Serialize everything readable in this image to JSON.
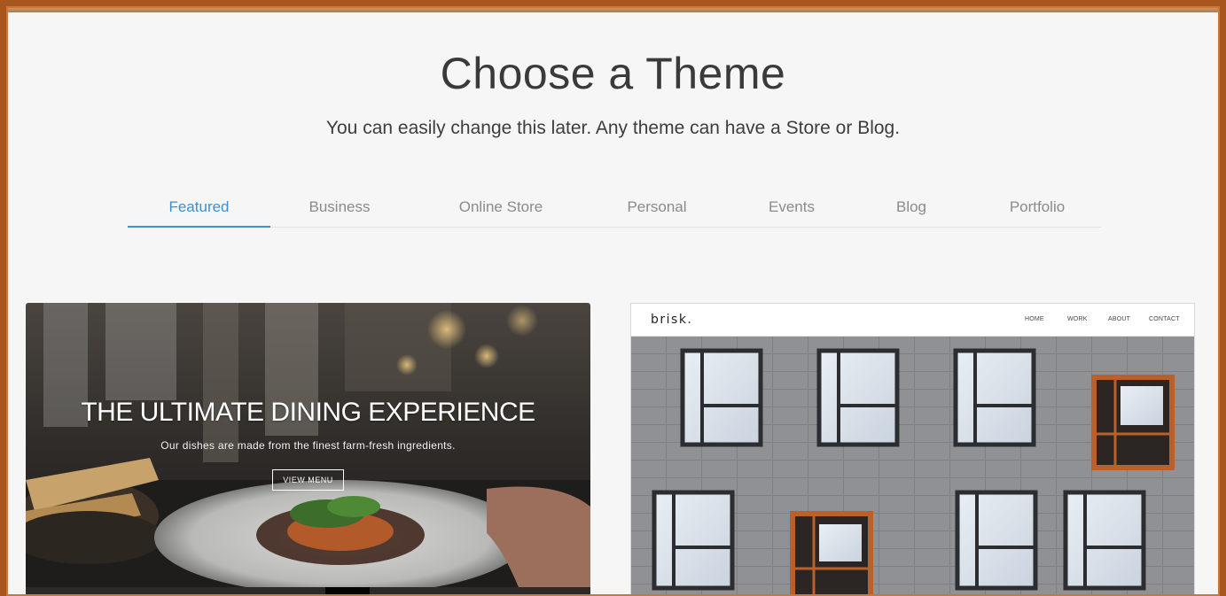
{
  "heading": {
    "title": "Choose a Theme",
    "subtitle": "You can easily change this later. Any theme can have a Store or Blog."
  },
  "tabs": [
    {
      "label": "Featured",
      "active": true
    },
    {
      "label": "Business",
      "active": false
    },
    {
      "label": "Online Store",
      "active": false
    },
    {
      "label": "Personal",
      "active": false
    },
    {
      "label": "Events",
      "active": false
    },
    {
      "label": "Blog",
      "active": false
    },
    {
      "label": "Portfolio",
      "active": false
    }
  ],
  "colors": {
    "accent": "#3d8fd1",
    "frame": "#a8561d",
    "background": "#f6f6f6"
  },
  "themes": {
    "dining": {
      "headline": "THE ULTIMATE DINING EXPERIENCE",
      "tagline": "Our dishes are made from the finest farm-fresh ingredients.",
      "button": "VIEW MENU"
    },
    "brisk": {
      "logo": "brisk.",
      "nav": [
        "HOME",
        "WORK",
        "ABOUT",
        "CONTACT"
      ]
    }
  }
}
